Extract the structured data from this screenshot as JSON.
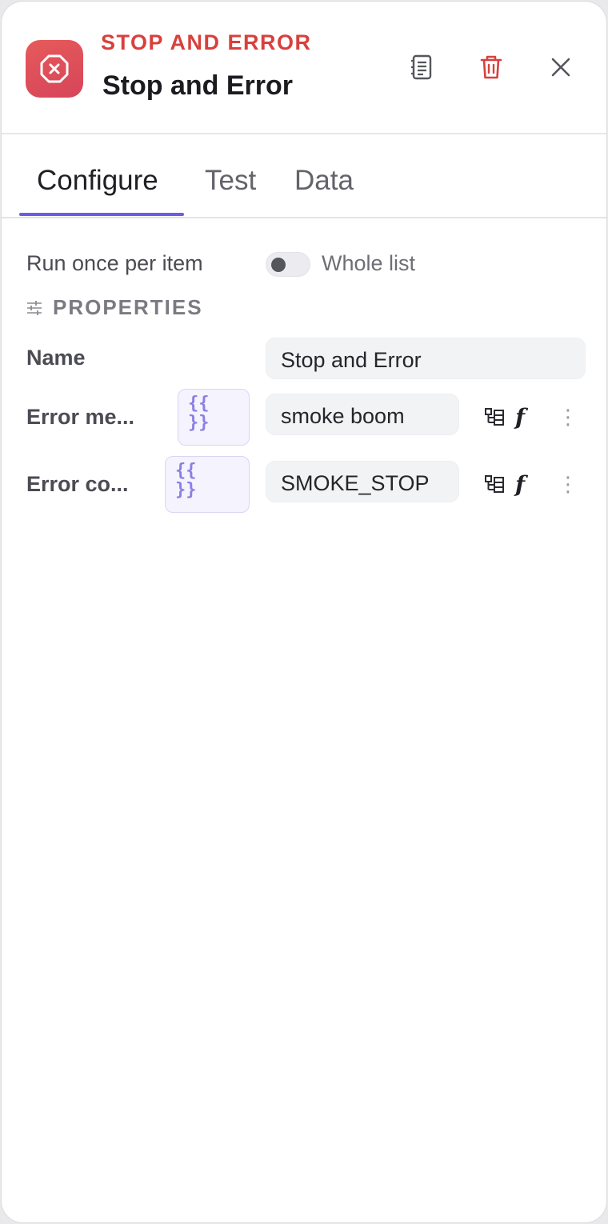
{
  "header": {
    "node_type": "STOP AND ERROR",
    "title": "Stop and Error",
    "icons": {
      "node": "stop-octagon-x-icon",
      "docs": "document-list-icon",
      "delete": "trash-icon",
      "close": "close-icon"
    },
    "colors": {
      "node_accent": "#d8403d",
      "delete_icon": "#d8403d"
    }
  },
  "tabs": [
    {
      "label": "Configure",
      "active": true
    },
    {
      "label": "Test",
      "active": false
    },
    {
      "label": "Data",
      "active": false
    }
  ],
  "mode": {
    "label": "Run once per item",
    "toggle_label": "Whole list",
    "toggle_on": false
  },
  "properties": {
    "heading": "PROPERTIES",
    "icon": "sliders-icon",
    "rows": [
      {
        "label": "Name",
        "value": "Stop and Error"
      },
      {
        "label": "Error me...",
        "expr_open": "{{",
        "expr_close": "}}",
        "value": "smoke boom",
        "fx": "f",
        "more": "⋮"
      },
      {
        "label": "Error co...",
        "expr_open": "{{",
        "expr_close": "}}",
        "value": "SMOKE_STOP",
        "fx": "f",
        "more": "⋮"
      }
    ]
  },
  "colors": {
    "tab_indicator": "#6b5ce7",
    "expression": "#8b7fe3"
  }
}
